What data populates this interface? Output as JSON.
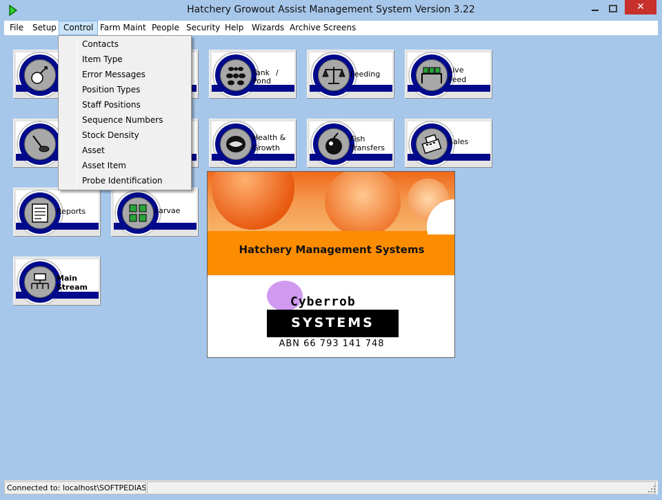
{
  "window": {
    "title": "Hatchery Growout Assist Management System Version 3.22",
    "close_glyph": "✕"
  },
  "menu": {
    "items": [
      {
        "label": "File"
      },
      {
        "label": "Setup"
      },
      {
        "label": "Control"
      },
      {
        "label": "Farm Maint"
      },
      {
        "label": "People"
      },
      {
        "label": "Security"
      },
      {
        "label": "Help"
      },
      {
        "label": "Wizards"
      },
      {
        "label": "Archive Screens"
      }
    ],
    "active": "Control"
  },
  "control_menu": {
    "items": [
      {
        "label": "Contacts"
      },
      {
        "label": "Item Type"
      },
      {
        "label": "Error Messages"
      },
      {
        "label": "Position Types"
      },
      {
        "label": "Staff Positions"
      },
      {
        "label": "Sequence Numbers"
      },
      {
        "label": "Stock Density"
      },
      {
        "label": "Asset"
      },
      {
        "label": "Asset Item"
      },
      {
        "label": "Probe Identification"
      }
    ]
  },
  "tiles": {
    "hatchery": {
      "line1": "",
      "icon": "broodstock-icon"
    },
    "tank_pond": {
      "line1": "Tank",
      "line1b": "/",
      "line2": "Pond",
      "icon": "tank-pond-icon"
    },
    "feeding": {
      "line1": "Feeding",
      "icon": "scales-icon"
    },
    "live_feed": {
      "line1": "Live",
      "line2": "Feed",
      "icon": "live-feed-icon"
    },
    "health": {
      "line1": "Health &",
      "line2": "Growth",
      "icon": "fish-health-icon"
    },
    "fish_transfers": {
      "line1": "Fish",
      "line2": "Transfers",
      "icon": "fish-transfer-icon"
    },
    "sales": {
      "line1": "Sales",
      "icon": "cash-register-icon"
    },
    "reports": {
      "line1": "Reports",
      "icon": "reports-icon"
    },
    "larvae": {
      "line1": "Larvae",
      "icon": "larvae-icon"
    },
    "main_stream": {
      "line1": "Main",
      "line2": "Stream",
      "icon": "main-stream-icon"
    }
  },
  "banner": {
    "headline": "Hatchery Management Systems",
    "brand_name": "Cyberrob",
    "brand_systems": "SYSTEMS",
    "abn": "ABN 66 793 141 748"
  },
  "status": {
    "connection": "Connected to: localhost\\SOFTPEDIAS"
  },
  "colors": {
    "background": "#a7c7ea",
    "tile_band": "#000a8a",
    "banner_orange": "#fd8d00",
    "close_red": "#c7302b"
  }
}
